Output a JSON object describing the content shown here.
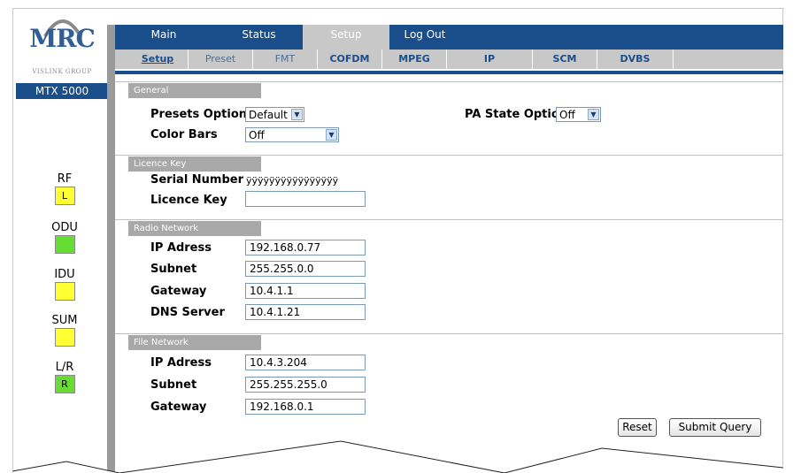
{
  "brand": {
    "logo_text": "MRC",
    "logo_subtitle": "VISLINK GROUP",
    "model": "MTX 5000"
  },
  "indicators": [
    {
      "label": "RF",
      "value": "L",
      "color": "#ffff33"
    },
    {
      "label": "ODU",
      "value": "",
      "color": "#66dd33"
    },
    {
      "label": "IDU",
      "value": "",
      "color": "#ffff33"
    },
    {
      "label": "SUM",
      "value": "",
      "color": "#ffff33"
    },
    {
      "label": "L/R",
      "value": "R",
      "color": "#66dd33"
    }
  ],
  "main_tabs": [
    {
      "label": "Main"
    },
    {
      "label": "Status"
    },
    {
      "label": "Setup",
      "active": true
    },
    {
      "label": "Log Out"
    }
  ],
  "sub_tabs": [
    {
      "label": "Setup",
      "active": true
    },
    {
      "label": "Preset"
    },
    {
      "label": "FMT"
    },
    {
      "label": "COFDM"
    },
    {
      "label": "MPEG"
    },
    {
      "label": "IP"
    },
    {
      "label": "SCM"
    },
    {
      "label": "DVBS"
    }
  ],
  "general": {
    "title": "General",
    "presets_option_label": "Presets Option",
    "presets_option_value": "Default",
    "color_bars_label": "Color Bars",
    "color_bars_value": "Off",
    "pa_state_label": "PA State Option",
    "pa_state_value": "Off"
  },
  "licence": {
    "title": "Licence Key",
    "serial_label": "Serial Number",
    "serial_value": "ÿÿÿÿÿÿÿÿÿÿÿÿÿÿÿÿ",
    "licence_label": "Licence Key",
    "licence_value": ""
  },
  "radio_network": {
    "title": "Radio Network",
    "ip_label": "IP Adress",
    "ip_value": "192.168.0.77",
    "subnet_label": "Subnet",
    "subnet_value": "255.255.0.0",
    "gateway_label": "Gateway",
    "gateway_value": "10.4.1.1",
    "dns_label": "DNS Server",
    "dns_value": "10.4.1.21"
  },
  "file_network": {
    "title": "File Network",
    "ip_label": "IP Adress",
    "ip_value": "10.4.3.204",
    "subnet_label": "Subnet",
    "subnet_value": "255.255.255.0",
    "gateway_label": "Gateway",
    "gateway_value": "192.168.0.1"
  },
  "buttons": {
    "reset": "Reset",
    "submit": "Submit Query"
  }
}
